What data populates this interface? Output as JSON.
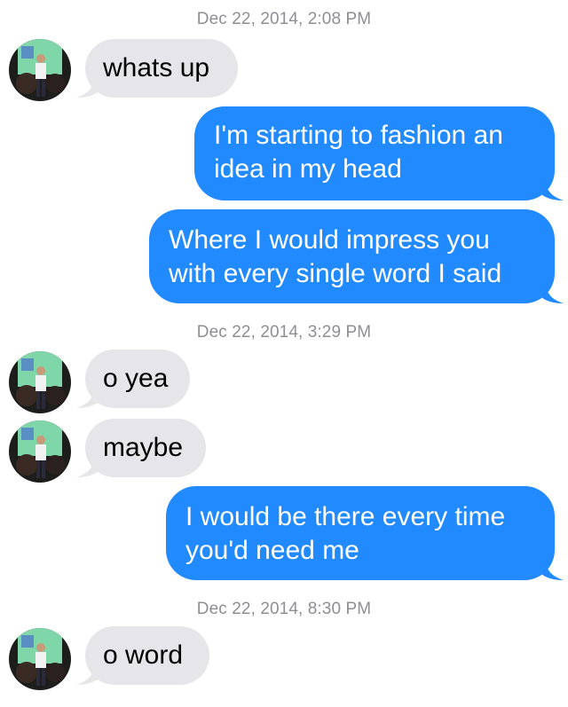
{
  "colors": {
    "incoming_bubble": "#e5e5ea",
    "outgoing_bubble": "#218aff",
    "timestamp_text": "#8e8e93"
  },
  "timestamps": [
    "Dec 22, 2014, 2:08 PM",
    "Dec 22, 2014, 3:29 PM",
    "Dec 22, 2014, 8:30 PM"
  ],
  "messages": [
    {
      "direction": "incoming",
      "lines": [
        "whats up"
      ],
      "avatar": "contact-photo"
    },
    {
      "direction": "outgoing",
      "lines": [
        "I'm starting to fashion an",
        "idea in my head"
      ]
    },
    {
      "direction": "outgoing",
      "lines": [
        "Where I would impress you",
        "with every single word I said"
      ]
    },
    {
      "direction": "incoming",
      "lines": [
        "o yea"
      ],
      "avatar": "contact-photo"
    },
    {
      "direction": "incoming",
      "lines": [
        "maybe"
      ],
      "avatar": "contact-photo"
    },
    {
      "direction": "outgoing",
      "lines": [
        "I would be there every time",
        "you'd need me"
      ]
    },
    {
      "direction": "incoming",
      "lines": [
        "o word"
      ],
      "avatar": "contact-photo"
    }
  ]
}
